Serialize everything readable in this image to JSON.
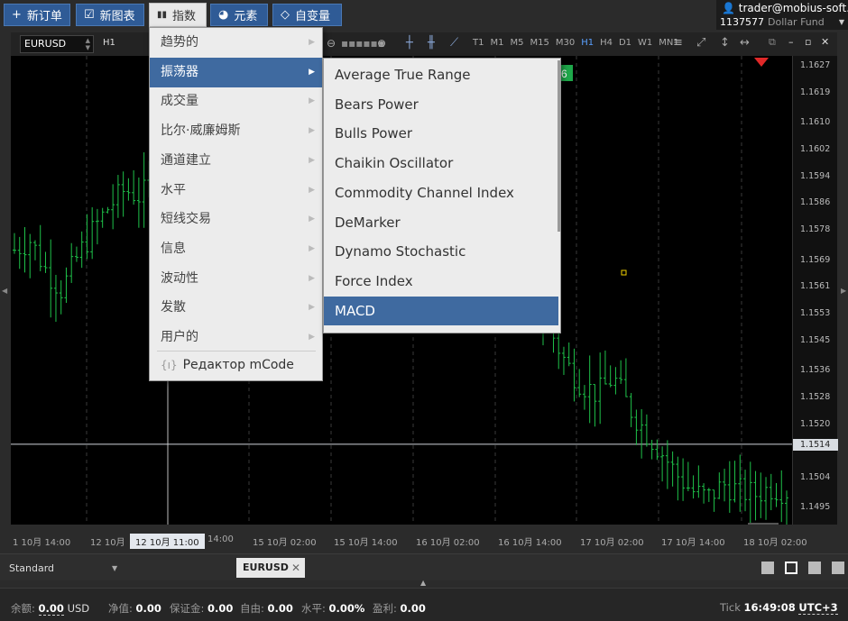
{
  "toolbar": {
    "new_order": "新订单",
    "new_chart": "新图表",
    "indicators": "指数",
    "elements": "元素",
    "variables": "自变量"
  },
  "account": {
    "email": "trader@mobius-soft.org",
    "number": "1137577",
    "fund": "Dollar Fund"
  },
  "chart_header": {
    "symbol": "EURUSD",
    "timeframe": "H1",
    "timeframes": [
      "T1",
      "M1",
      "M5",
      "M15",
      "M30",
      "H1",
      "H4",
      "D1",
      "W1",
      "MN1"
    ],
    "active_timeframe": "H1"
  },
  "indicators_menu": {
    "items": [
      "趋势的",
      "振荡器",
      "成交量",
      "比尔·威廉姆斯",
      "通道建立",
      "水平",
      "短线交易",
      "信息",
      "波动性",
      "发散",
      "用户的"
    ],
    "selected": "振荡器",
    "mcode": "Редактор mCode"
  },
  "oscillators_menu": {
    "items": [
      "Average True Range",
      "Bears Power",
      "Bulls Power",
      "Chaikin Oscillator",
      "Commodity Channel Index",
      "DeMarker",
      "Dynamo Stochastic",
      "Force Index",
      "MACD"
    ],
    "selected": "MACD"
  },
  "chart_data": {
    "type": "candlestick",
    "symbol": "EURUSD",
    "price_ticks": [
      "1.1627",
      "1.1619",
      "1.1610",
      "1.1602",
      "1.1594",
      "1.1586",
      "1.1578",
      "1.1569",
      "1.1561",
      "1.1553",
      "1.1545",
      "1.1536",
      "1.1528",
      "1.1520",
      "1.1514",
      "1.1504",
      "1.1495"
    ],
    "current_price": "1.1514",
    "time_ticks": [
      "1 10月 14:00",
      "12 10月",
      "12 10月 11:00",
      "14:00",
      "15 10月 02:00",
      "15 10月 14:00",
      "16 10月 02:00",
      "16 10月 14:00",
      "17 10月 02:00",
      "17 10月 14:00",
      "18 10月 02:00"
    ],
    "crosshair_time": "12 10月 11:00",
    "badge": "6",
    "ylim": [
      1.149,
      1.163
    ],
    "close_series": [
      1.1572,
      1.1575,
      1.1566,
      1.156,
      1.157,
      1.1578,
      1.1585,
      1.159,
      1.1588,
      1.1593,
      1.1596,
      1.16,
      1.1605,
      1.1598,
      1.1602,
      1.1608,
      1.1612,
      1.1604,
      1.1578,
      1.1574,
      1.1576,
      1.1579,
      1.1572,
      1.1574,
      1.1577,
      1.1568,
      1.1562,
      1.156,
      1.1563,
      1.1566,
      1.1572,
      1.1569,
      1.156,
      1.1557,
      1.1548,
      1.1538,
      1.1532,
      1.1529,
      1.1534,
      1.1525,
      1.1518,
      1.1512,
      1.1505,
      1.15,
      1.1498,
      1.1502,
      1.15,
      1.1499,
      1.1501,
      1.15
    ]
  },
  "tabs": {
    "profile": "Standard",
    "symbol_tab": "EURUSD"
  },
  "status": {
    "balance_label": "余额:",
    "balance": "0.00",
    "currency": "USD",
    "equity_label": "净值:",
    "equity": "0.00",
    "margin_label": "保证金:",
    "margin": "0.00",
    "free_label": "自由:",
    "free": "0.00",
    "level_label": "水平:",
    "level": "0.00%",
    "profit_label": "盈利:",
    "profit": "0.00",
    "tick_label": "Tick",
    "time": "16:49:08",
    "tz": "UTC+3"
  }
}
